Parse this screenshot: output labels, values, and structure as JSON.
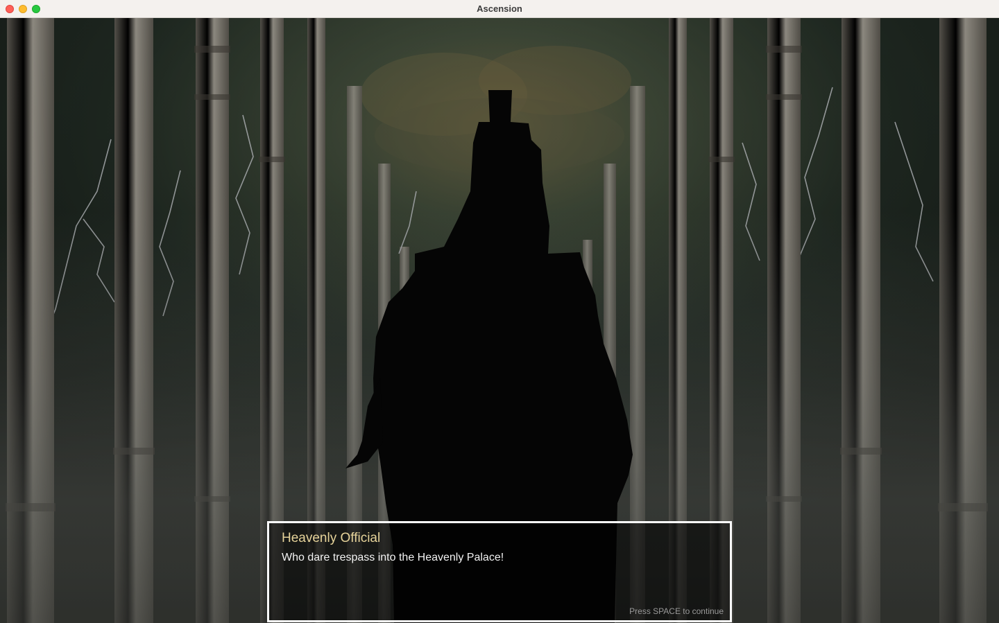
{
  "window": {
    "title": "Ascension"
  },
  "dialogue": {
    "speaker": "Heavenly Official",
    "text": "Who dare trespass into the Heavenly Palace!",
    "hint": "Press SPACE to continue"
  },
  "colors": {
    "speaker": "#e6d39a",
    "dialogue_border": "#ffffff",
    "pillar": "#a8a397",
    "sky": "#2e3a2c",
    "lightning": "#e4e8ec"
  }
}
